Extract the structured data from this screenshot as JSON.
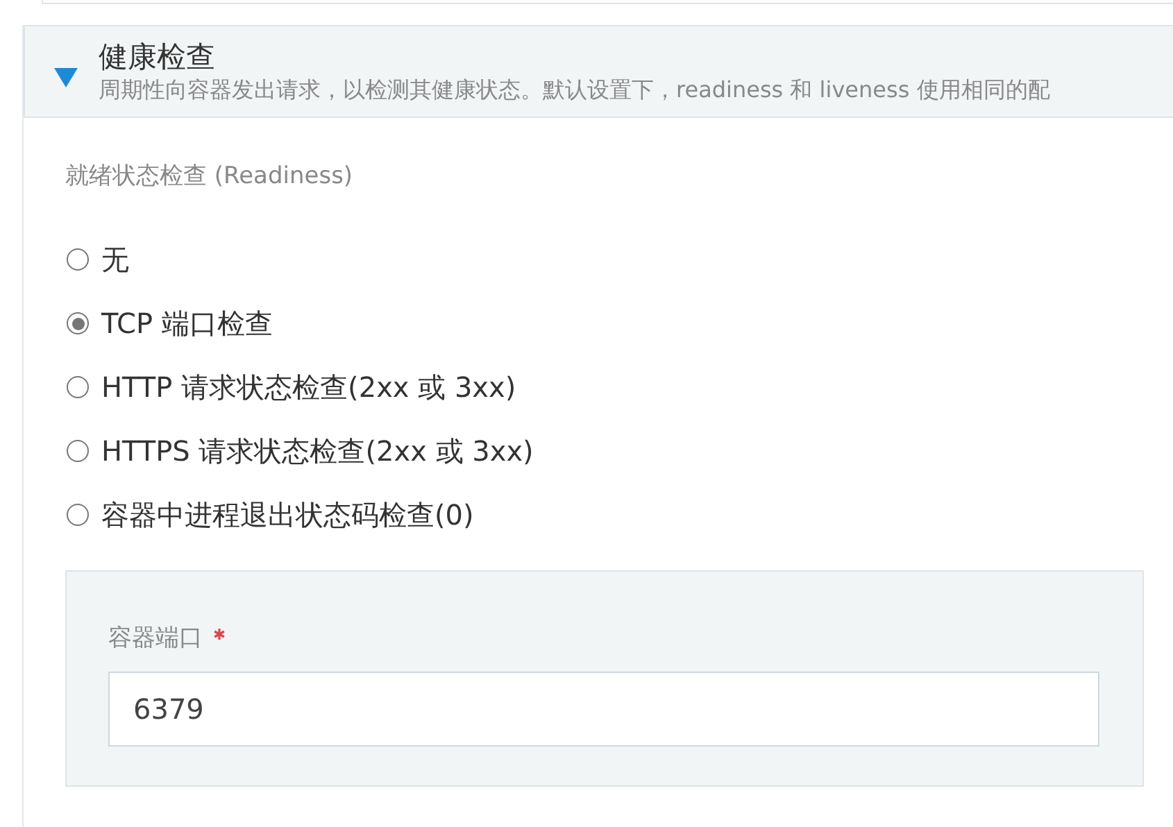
{
  "section": {
    "title": "健康检查",
    "expanded": true,
    "description": "周期性向容器发出请求，以检测其健康状态。默认设置下，readiness 和 liveness 使用相同的配"
  },
  "readiness": {
    "label": "就绪状态检查 (Readiness)",
    "options": [
      {
        "label": "无",
        "selected": false
      },
      {
        "label": "TCP 端口检查",
        "selected": true
      },
      {
        "label": "HTTP 请求状态检查(2xx 或 3xx)",
        "selected": false
      },
      {
        "label": "HTTPS 请求状态检查(2xx 或 3xx)",
        "selected": false
      },
      {
        "label": "容器中进程退出状态码检查(0)",
        "selected": false
      }
    ]
  },
  "port_field": {
    "label": "容器端口",
    "required": true,
    "value": "6379"
  }
}
